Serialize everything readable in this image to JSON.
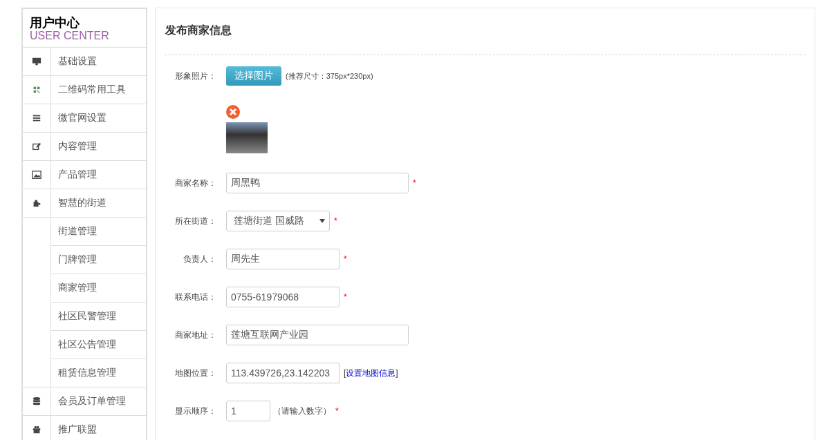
{
  "sidebar": {
    "title": "用户中心",
    "subtitle": "USER CENTER",
    "items": [
      {
        "label": "基础设置"
      },
      {
        "label": "二维码常用工具"
      },
      {
        "label": "微官网设置"
      },
      {
        "label": "内容管理"
      },
      {
        "label": "产品管理"
      },
      {
        "label": "智慧的街道",
        "children": [
          {
            "label": "街道管理"
          },
          {
            "label": "门牌管理"
          },
          {
            "label": "商家管理"
          },
          {
            "label": "社区民警管理"
          },
          {
            "label": "社区公告管理"
          },
          {
            "label": "租赁信息管理"
          }
        ]
      },
      {
        "label": "会员及订单管理"
      },
      {
        "label": "推广联盟"
      }
    ]
  },
  "form": {
    "title": "发布商家信息",
    "photo": {
      "label": "形象照片：",
      "button": "选择图片",
      "hint": "(推荐尺寸：375px*230px)"
    },
    "fields": [
      {
        "label": "商家名称：",
        "kind": "text",
        "value": "周黑鸭",
        "required_mark": "*"
      },
      {
        "label": "所在街道：",
        "kind": "select",
        "value": "莲塘街道 国威路",
        "required_mark": "*"
      },
      {
        "label": "负责人：",
        "kind": "text",
        "value": "周先生",
        "required_mark": "*"
      },
      {
        "label": "联系电话：",
        "kind": "text",
        "value": "0755-61979068",
        "required_mark": "*"
      },
      {
        "label": "商家地址：",
        "kind": "text",
        "value": "莲塘互联网产业园"
      },
      {
        "label": "地图位置：",
        "kind": "text",
        "value": "113.439726,23.142203",
        "link_open": "[",
        "link": "设置地图信息",
        "link_close": "]"
      },
      {
        "label": "显示顺序：",
        "kind": "text",
        "value": "1",
        "note": "（请输入数字）",
        "required_mark": "*"
      }
    ]
  }
}
